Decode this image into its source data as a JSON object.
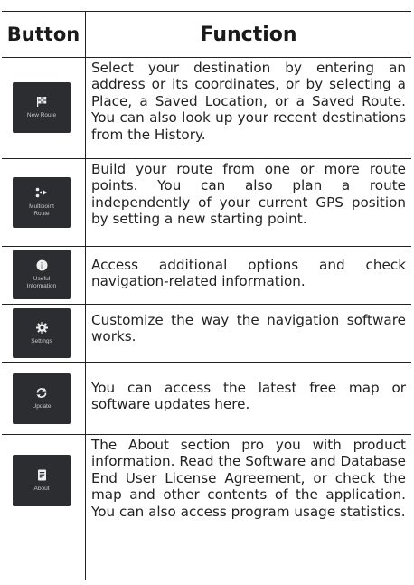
{
  "header": {
    "col_button": "Button",
    "col_function": "Function"
  },
  "rows": [
    {
      "icon": "flag-icon",
      "button_label": "New Route",
      "text": "Select your destination by entering an address or its coordinates, or by selecting a Place, a Saved Location, or a Saved Route. You can also look up your recent destinations from the History."
    },
    {
      "icon": "multipoint-route-icon",
      "button_label": "Multipoint Route",
      "text": "Build your route from one or more route points. You can also plan a route independently of your current GPS position by setting a new starting point."
    },
    {
      "icon": "info-icon",
      "button_label": "Useful Information",
      "text": "Access additional options and check navigation-related information."
    },
    {
      "icon": "gear-icon",
      "button_label": "Settings",
      "text": "Customize the way the navigation software works."
    },
    {
      "icon": "refresh-icon",
      "button_label": "Update",
      "text": "You can access the latest free map or software updates here."
    },
    {
      "icon": "document-icon",
      "button_label": "About",
      "text": "The About section pro you with product information. Read the Software and Database End User License Agreement, or check the map and other contents of the application. You can also access program usage statistics."
    }
  ]
}
